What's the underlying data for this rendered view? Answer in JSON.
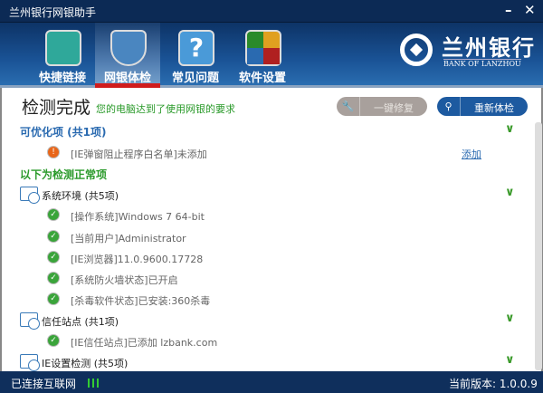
{
  "window": {
    "title": "兰州银行网银助手",
    "minimize": "–",
    "close": "✕"
  },
  "nav": {
    "tabs": [
      {
        "label": "快捷链接"
      },
      {
        "label": "网银体检"
      },
      {
        "label": "常见问题"
      },
      {
        "label": "软件设置"
      }
    ],
    "active": 1
  },
  "logo": {
    "cn": "兰州银行",
    "en": "BANK OF LANZHOU"
  },
  "main": {
    "title": "检测完成",
    "subtitle": "您的电脑达到了使用网银的要求",
    "repair_button": "一键修复",
    "recheck_button": "重新体检",
    "optimize": {
      "header": "可优化项 (共1项)",
      "items": [
        {
          "text": "[IE弹窗阻止程序白名单]未添加",
          "action": "添加"
        }
      ]
    },
    "normal_header": "以下为检测正常项",
    "groups": [
      {
        "header": "系统环境 (共5项)",
        "items": [
          "[操作系统]Windows 7 64-bit",
          "[当前用户]Administrator",
          "[IE浏览器]11.0.9600.17728",
          "[系统防火墙状态]已开启",
          "[杀毒软件状态]已安装:360杀毒"
        ]
      },
      {
        "header": "信任站点 (共1项)",
        "items": [
          "[IE信任站点]已添加 lzbank.com"
        ]
      },
      {
        "header": "IE设置检测 (共5项)",
        "items": []
      }
    ]
  },
  "status": {
    "connection": "已连接互联网",
    "version": "当前版本: 1.0.0.9"
  }
}
